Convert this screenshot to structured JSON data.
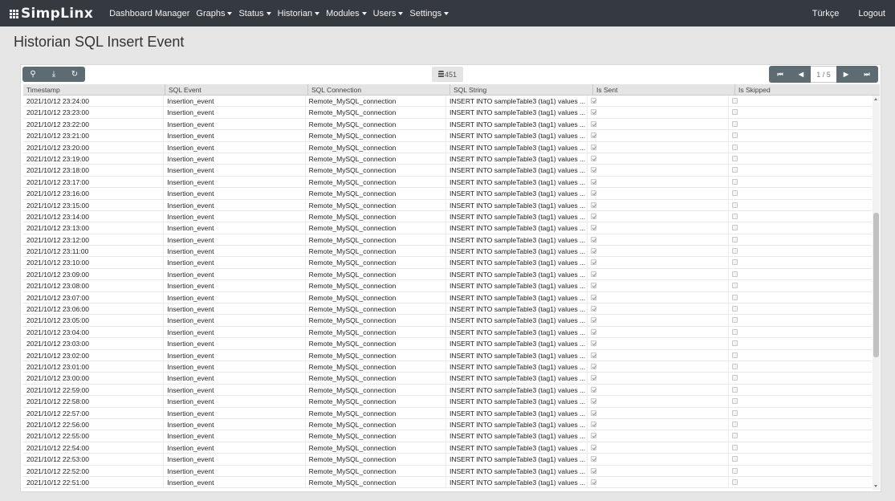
{
  "navbar": {
    "brand": "SimpLinx",
    "items": [
      {
        "label": "Dashboard Manager",
        "dropdown": false
      },
      {
        "label": "Graphs",
        "dropdown": true
      },
      {
        "label": "Status",
        "dropdown": true
      },
      {
        "label": "Historian",
        "dropdown": true
      },
      {
        "label": "Modules",
        "dropdown": true
      },
      {
        "label": "Users",
        "dropdown": true
      },
      {
        "label": "Settings",
        "dropdown": true
      }
    ],
    "language": "Türkçe",
    "logout": "Logout"
  },
  "page": {
    "title": "Historian SQL Insert Event"
  },
  "toolbar": {
    "buttons": [
      {
        "icon": "search-icon",
        "glyph": "⚲"
      },
      {
        "icon": "download-icon",
        "glyph": "⤓"
      },
      {
        "icon": "refresh-icon",
        "glyph": "↻"
      }
    ],
    "record_count": "451"
  },
  "pager": {
    "first": "⏮",
    "prev": "◀",
    "page": "1 / 5",
    "next": "▶",
    "last": "⏭"
  },
  "table": {
    "columns": [
      "Timestamp",
      "SQL Event",
      "SQL Connection",
      "SQL String",
      "Is Sent",
      "Is Skipped"
    ],
    "rows": [
      {
        "ts": "2021/10/12 23:24:00",
        "event": "Insertion_event",
        "conn": "Remote_MySQL_connection",
        "sql": "INSERT INTO sampleTable3 (tag1) values ...",
        "sent": true,
        "skipped": false
      },
      {
        "ts": "2021/10/12 23:23:00",
        "event": "Insertion_event",
        "conn": "Remote_MySQL_connection",
        "sql": "INSERT INTO sampleTable3 (tag1) values ...",
        "sent": true,
        "skipped": false
      },
      {
        "ts": "2021/10/12 23:22:00",
        "event": "Insertion_event",
        "conn": "Remote_MySQL_connection",
        "sql": "INSERT INTO sampleTable3 (tag1) values ...",
        "sent": true,
        "skipped": false
      },
      {
        "ts": "2021/10/12 23:21:00",
        "event": "Insertion_event",
        "conn": "Remote_MySQL_connection",
        "sql": "INSERT INTO sampleTable3 (tag1) values ...",
        "sent": true,
        "skipped": false
      },
      {
        "ts": "2021/10/12 23:20:00",
        "event": "Insertion_event",
        "conn": "Remote_MySQL_connection",
        "sql": "INSERT INTO sampleTable3 (tag1) values ...",
        "sent": true,
        "skipped": false
      },
      {
        "ts": "2021/10/12 23:19:00",
        "event": "Insertion_event",
        "conn": "Remote_MySQL_connection",
        "sql": "INSERT INTO sampleTable3 (tag1) values ...",
        "sent": true,
        "skipped": false
      },
      {
        "ts": "2021/10/12 23:18:00",
        "event": "Insertion_event",
        "conn": "Remote_MySQL_connection",
        "sql": "INSERT INTO sampleTable3 (tag1) values ...",
        "sent": true,
        "skipped": false
      },
      {
        "ts": "2021/10/12 23:17:00",
        "event": "Insertion_event",
        "conn": "Remote_MySQL_connection",
        "sql": "INSERT INTO sampleTable3 (tag1) values ...",
        "sent": true,
        "skipped": false
      },
      {
        "ts": "2021/10/12 23:16:00",
        "event": "Insertion_event",
        "conn": "Remote_MySQL_connection",
        "sql": "INSERT INTO sampleTable3 (tag1) values ...",
        "sent": true,
        "skipped": false
      },
      {
        "ts": "2021/10/12 23:15:00",
        "event": "Insertion_event",
        "conn": "Remote_MySQL_connection",
        "sql": "INSERT INTO sampleTable3 (tag1) values ...",
        "sent": true,
        "skipped": false
      },
      {
        "ts": "2021/10/12 23:14:00",
        "event": "Insertion_event",
        "conn": "Remote_MySQL_connection",
        "sql": "INSERT INTO sampleTable3 (tag1) values ...",
        "sent": true,
        "skipped": false
      },
      {
        "ts": "2021/10/12 23:13:00",
        "event": "Insertion_event",
        "conn": "Remote_MySQL_connection",
        "sql": "INSERT INTO sampleTable3 (tag1) values ...",
        "sent": true,
        "skipped": false
      },
      {
        "ts": "2021/10/12 23:12:00",
        "event": "Insertion_event",
        "conn": "Remote_MySQL_connection",
        "sql": "INSERT INTO sampleTable3 (tag1) values ...",
        "sent": true,
        "skipped": false
      },
      {
        "ts": "2021/10/12 23:11:00",
        "event": "Insertion_event",
        "conn": "Remote_MySQL_connection",
        "sql": "INSERT INTO sampleTable3 (tag1) values ...",
        "sent": true,
        "skipped": false
      },
      {
        "ts": "2021/10/12 23:10:00",
        "event": "Insertion_event",
        "conn": "Remote_MySQL_connection",
        "sql": "INSERT INTO sampleTable3 (tag1) values ...",
        "sent": true,
        "skipped": false
      },
      {
        "ts": "2021/10/12 23:09:00",
        "event": "Insertion_event",
        "conn": "Remote_MySQL_connection",
        "sql": "INSERT INTO sampleTable3 (tag1) values ...",
        "sent": true,
        "skipped": false
      },
      {
        "ts": "2021/10/12 23:08:00",
        "event": "Insertion_event",
        "conn": "Remote_MySQL_connection",
        "sql": "INSERT INTO sampleTable3 (tag1) values ...",
        "sent": true,
        "skipped": false
      },
      {
        "ts": "2021/10/12 23:07:00",
        "event": "Insertion_event",
        "conn": "Remote_MySQL_connection",
        "sql": "INSERT INTO sampleTable3 (tag1) values ...",
        "sent": true,
        "skipped": false
      },
      {
        "ts": "2021/10/12 23:06:00",
        "event": "Insertion_event",
        "conn": "Remote_MySQL_connection",
        "sql": "INSERT INTO sampleTable3 (tag1) values ...",
        "sent": true,
        "skipped": false
      },
      {
        "ts": "2021/10/12 23:05:00",
        "event": "Insertion_event",
        "conn": "Remote_MySQL_connection",
        "sql": "INSERT INTO sampleTable3 (tag1) values ...",
        "sent": true,
        "skipped": false
      },
      {
        "ts": "2021/10/12 23:04:00",
        "event": "Insertion_event",
        "conn": "Remote_MySQL_connection",
        "sql": "INSERT INTO sampleTable3 (tag1) values ...",
        "sent": true,
        "skipped": false
      },
      {
        "ts": "2021/10/12 23:03:00",
        "event": "Insertion_event",
        "conn": "Remote_MySQL_connection",
        "sql": "INSERT INTO sampleTable3 (tag1) values ...",
        "sent": true,
        "skipped": false
      },
      {
        "ts": "2021/10/12 23:02:00",
        "event": "Insertion_event",
        "conn": "Remote_MySQL_connection",
        "sql": "INSERT INTO sampleTable3 (tag1) values ...",
        "sent": true,
        "skipped": false
      },
      {
        "ts": "2021/10/12 23:01:00",
        "event": "Insertion_event",
        "conn": "Remote_MySQL_connection",
        "sql": "INSERT INTO sampleTable3 (tag1) values ...",
        "sent": true,
        "skipped": false
      },
      {
        "ts": "2021/10/12 23:00:00",
        "event": "Insertion_event",
        "conn": "Remote_MySQL_connection",
        "sql": "INSERT INTO sampleTable3 (tag1) values ...",
        "sent": true,
        "skipped": false
      },
      {
        "ts": "2021/10/12 22:59:00",
        "event": "Insertion_event",
        "conn": "Remote_MySQL_connection",
        "sql": "INSERT INTO sampleTable3 (tag1) values ...",
        "sent": true,
        "skipped": false
      },
      {
        "ts": "2021/10/12 22:58:00",
        "event": "Insertion_event",
        "conn": "Remote_MySQL_connection",
        "sql": "INSERT INTO sampleTable3 (tag1) values ...",
        "sent": true,
        "skipped": false
      },
      {
        "ts": "2021/10/12 22:57:00",
        "event": "Insertion_event",
        "conn": "Remote_MySQL_connection",
        "sql": "INSERT INTO sampleTable3 (tag1) values ...",
        "sent": true,
        "skipped": false
      },
      {
        "ts": "2021/10/12 22:56:00",
        "event": "Insertion_event",
        "conn": "Remote_MySQL_connection",
        "sql": "INSERT INTO sampleTable3 (tag1) values ...",
        "sent": true,
        "skipped": false
      },
      {
        "ts": "2021/10/12 22:55:00",
        "event": "Insertion_event",
        "conn": "Remote_MySQL_connection",
        "sql": "INSERT INTO sampleTable3 (tag1) values ...",
        "sent": true,
        "skipped": false
      },
      {
        "ts": "2021/10/12 22:54:00",
        "event": "Insertion_event",
        "conn": "Remote_MySQL_connection",
        "sql": "INSERT INTO sampleTable3 (tag1) values ...",
        "sent": true,
        "skipped": false
      },
      {
        "ts": "2021/10/12 22:53:00",
        "event": "Insertion_event",
        "conn": "Remote_MySQL_connection",
        "sql": "INSERT INTO sampleTable3 (tag1) values ...",
        "sent": true,
        "skipped": false
      },
      {
        "ts": "2021/10/12 22:52:00",
        "event": "Insertion_event",
        "conn": "Remote_MySQL_connection",
        "sql": "INSERT INTO sampleTable3 (tag1) values ...",
        "sent": true,
        "skipped": false
      },
      {
        "ts": "2021/10/12 22:51:00",
        "event": "Insertion_event",
        "conn": "Remote_MySQL_connection",
        "sql": "INSERT INTO sampleTable3 (tag1) values ...",
        "sent": true,
        "skipped": false
      }
    ]
  }
}
